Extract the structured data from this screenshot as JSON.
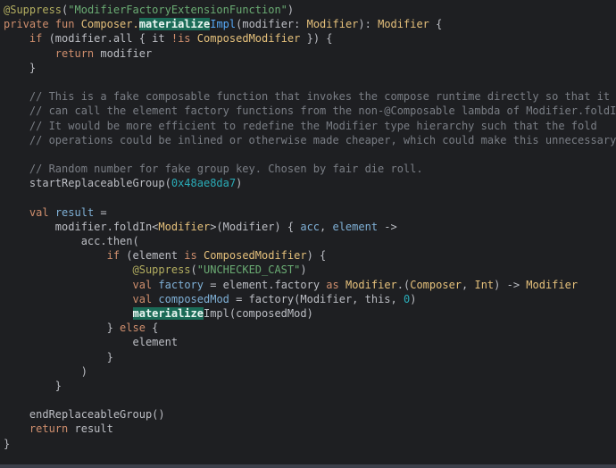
{
  "lines": [
    [
      {
        "t": "@Suppress",
        "c": "ann"
      },
      {
        "t": "(",
        "c": ""
      },
      {
        "t": "\"ModifierFactoryExtensionFunction\"",
        "c": "str"
      },
      {
        "t": ")",
        "c": ""
      }
    ],
    [
      {
        "t": "private fun ",
        "c": "kw"
      },
      {
        "t": "Composer.",
        "c": "typ"
      },
      {
        "t": "materialize",
        "c": "hl"
      },
      {
        "t": "Impl",
        "c": "fn"
      },
      {
        "t": "(modifier: ",
        "c": ""
      },
      {
        "t": "Modifier",
        "c": "typ"
      },
      {
        "t": "): ",
        "c": ""
      },
      {
        "t": "Modifier",
        "c": "typ"
      },
      {
        "t": " {",
        "c": ""
      }
    ],
    [
      {
        "t": "    ",
        "c": ""
      },
      {
        "t": "if",
        "c": "kw"
      },
      {
        "t": " (modifier.all { it ",
        "c": ""
      },
      {
        "t": "!is",
        "c": "kw"
      },
      {
        "t": " ",
        "c": ""
      },
      {
        "t": "ComposedModifier",
        "c": "typ"
      },
      {
        "t": " }) {",
        "c": ""
      }
    ],
    [
      {
        "t": "        ",
        "c": ""
      },
      {
        "t": "return",
        "c": "kw"
      },
      {
        "t": " modifier",
        "c": ""
      }
    ],
    [
      {
        "t": "    }",
        "c": ""
      }
    ],
    [
      {
        "t": "",
        "c": ""
      }
    ],
    [
      {
        "t": "    // This is a fake composable function that invokes the compose runtime directly so that it",
        "c": "cmt"
      }
    ],
    [
      {
        "t": "    // can call the element factory functions from the non-@Composable lambda of Modifier.foldIn.",
        "c": "cmt"
      }
    ],
    [
      {
        "t": "    // It would be more efficient to redefine the Modifier type hierarchy such that the fold",
        "c": "cmt"
      }
    ],
    [
      {
        "t": "    // operations could be inlined or otherwise made cheaper, which could make this unnecessary.",
        "c": "cmt"
      }
    ],
    [
      {
        "t": "",
        "c": ""
      }
    ],
    [
      {
        "t": "    // Random number for fake group key. Chosen by fair die roll.",
        "c": "cmt"
      }
    ],
    [
      {
        "t": "    startReplaceableGroup(",
        "c": ""
      },
      {
        "t": "0x48ae8da7",
        "c": "num"
      },
      {
        "t": ")",
        "c": ""
      }
    ],
    [
      {
        "t": "",
        "c": ""
      }
    ],
    [
      {
        "t": "    ",
        "c": ""
      },
      {
        "t": "val",
        "c": "kw"
      },
      {
        "t": " ",
        "c": ""
      },
      {
        "t": "result",
        "c": "lvar"
      },
      {
        "t": " =",
        "c": ""
      }
    ],
    [
      {
        "t": "        modifier.foldIn<",
        "c": ""
      },
      {
        "t": "Modifier",
        "c": "typ"
      },
      {
        "t": ">(Modifier) { ",
        "c": ""
      },
      {
        "t": "acc",
        "c": "lvar"
      },
      {
        "t": ", ",
        "c": ""
      },
      {
        "t": "element",
        "c": "lvar"
      },
      {
        "t": " ->",
        "c": ""
      }
    ],
    [
      {
        "t": "            acc.then(",
        "c": ""
      }
    ],
    [
      {
        "t": "                ",
        "c": ""
      },
      {
        "t": "if",
        "c": "kw"
      },
      {
        "t": " (element ",
        "c": ""
      },
      {
        "t": "is",
        "c": "kw"
      },
      {
        "t": " ",
        "c": ""
      },
      {
        "t": "ComposedModifier",
        "c": "typ"
      },
      {
        "t": ") {",
        "c": ""
      }
    ],
    [
      {
        "t": "                    ",
        "c": ""
      },
      {
        "t": "@Suppress",
        "c": "ann"
      },
      {
        "t": "(",
        "c": ""
      },
      {
        "t": "\"UNCHECKED_CAST\"",
        "c": "str"
      },
      {
        "t": ")",
        "c": ""
      }
    ],
    [
      {
        "t": "                    ",
        "c": ""
      },
      {
        "t": "val",
        "c": "kw"
      },
      {
        "t": " ",
        "c": ""
      },
      {
        "t": "factory",
        "c": "lvar"
      },
      {
        "t": " = element.factory ",
        "c": ""
      },
      {
        "t": "as",
        "c": "kw"
      },
      {
        "t": " ",
        "c": ""
      },
      {
        "t": "Modifier",
        "c": "typ"
      },
      {
        "t": ".(",
        "c": ""
      },
      {
        "t": "Composer",
        "c": "typ"
      },
      {
        "t": ", ",
        "c": ""
      },
      {
        "t": "Int",
        "c": "typ"
      },
      {
        "t": ") -> ",
        "c": ""
      },
      {
        "t": "Modifier",
        "c": "typ"
      }
    ],
    [
      {
        "t": "                    ",
        "c": ""
      },
      {
        "t": "val",
        "c": "kw"
      },
      {
        "t": " ",
        "c": ""
      },
      {
        "t": "composedMod",
        "c": "lvar"
      },
      {
        "t": " = factory(Modifier, this, ",
        "c": ""
      },
      {
        "t": "0",
        "c": "num"
      },
      {
        "t": ")",
        "c": ""
      }
    ],
    [
      {
        "t": "                    ",
        "c": ""
      },
      {
        "t": "materialize",
        "c": "hl"
      },
      {
        "t": "Impl(composedMod)",
        "c": ""
      }
    ],
    [
      {
        "t": "                } ",
        "c": ""
      },
      {
        "t": "else",
        "c": "kw"
      },
      {
        "t": " {",
        "c": ""
      }
    ],
    [
      {
        "t": "                    element",
        "c": ""
      }
    ],
    [
      {
        "t": "                }",
        "c": ""
      }
    ],
    [
      {
        "t": "            )",
        "c": ""
      }
    ],
    [
      {
        "t": "        }",
        "c": ""
      }
    ],
    [
      {
        "t": "",
        "c": ""
      }
    ],
    [
      {
        "t": "    endReplaceableGroup()",
        "c": ""
      }
    ],
    [
      {
        "t": "    ",
        "c": ""
      },
      {
        "t": "return",
        "c": "kw"
      },
      {
        "t": " result",
        "c": ""
      }
    ],
    [
      {
        "t": "}",
        "c": ""
      }
    ]
  ]
}
